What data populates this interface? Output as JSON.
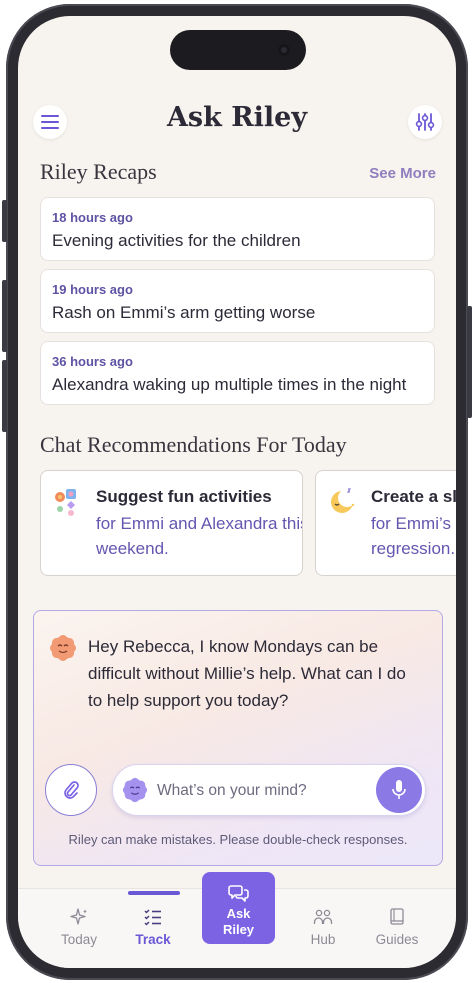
{
  "header": {
    "title": "Ask Riley",
    "menu_icon": "hamburger-menu-icon",
    "settings_icon": "sliders-icon"
  },
  "recaps": {
    "section_title": "Riley Recaps",
    "see_more_label": "See More",
    "items": [
      {
        "time": "18 hours ago",
        "text": "Evening activities for the children"
      },
      {
        "time": "19 hours ago",
        "text": "Rash on Emmi’s arm getting worse"
      },
      {
        "time": "36 hours ago",
        "text": "Alexandra waking up multiple times in the night"
      }
    ]
  },
  "recommendations": {
    "section_title": "Chat Recommendations For Today",
    "cards": [
      {
        "icon": "toys-icon",
        "head": "Suggest fun activities",
        "sub": "for Emmi and Alexandra this weekend."
      },
      {
        "icon": "sleeping-moon-icon",
        "head": "Create a sleep plan",
        "sub": "for Emmi’s sleep regression."
      }
    ]
  },
  "chat": {
    "message": "Hey Rebecca, I know Mondays can be difficult without Millie’s help. What can I do to help support you today?",
    "input_placeholder": "What’s on your mind?",
    "attach_icon": "paperclip-icon",
    "mic_icon": "microphone-icon",
    "disclaimer": "Riley can make mistakes. Please double-check responses."
  },
  "tabbar": {
    "tabs": [
      {
        "label": "Today",
        "icon": "sparkle-icon"
      },
      {
        "label": "Track",
        "icon": "checklist-icon",
        "active": true
      },
      {
        "label": "Ask Riley",
        "icon": "chat-bubbles-icon"
      },
      {
        "label": "Hub",
        "icon": "people-icon"
      },
      {
        "label": "Guides",
        "icon": "book-icon"
      }
    ]
  },
  "colors": {
    "accent": "#7b63e4",
    "background": "#f7f3ee",
    "link": "#6456b0"
  }
}
